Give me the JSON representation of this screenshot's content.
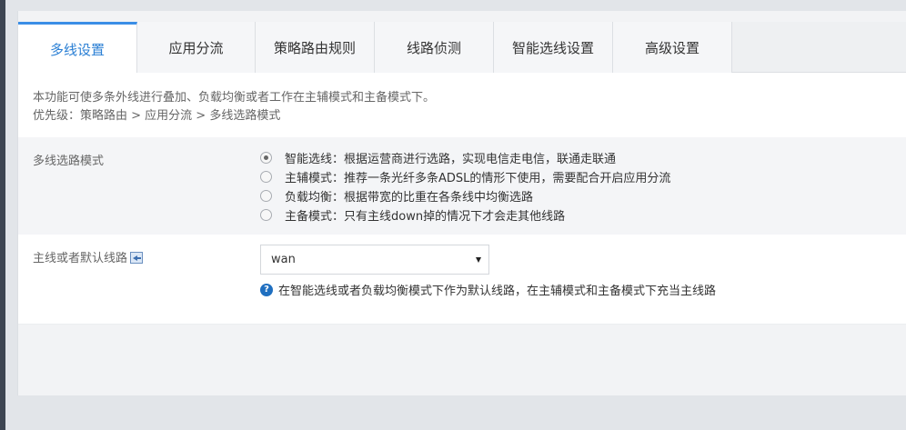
{
  "tabs": [
    {
      "label": "多线设置",
      "active": true
    },
    {
      "label": "应用分流",
      "active": false
    },
    {
      "label": "策略路由规则",
      "active": false
    },
    {
      "label": "线路侦测",
      "active": false
    },
    {
      "label": "智能选线设置",
      "active": false
    },
    {
      "label": "高级设置",
      "active": false
    }
  ],
  "description": {
    "line1": "本功能可使多条外线进行叠加、负载均衡或者工作在主辅模式和主备模式下。",
    "line2": "优先级：策略路由 > 应用分流 > 多线选路模式"
  },
  "mode": {
    "label": "多线选路模式",
    "options": [
      {
        "label": "智能选线：根据运营商进行选路，实现电信走电信，联通走联通",
        "checked": true
      },
      {
        "label": "主辅模式：推荐一条光纤多条ADSL的情形下使用，需要配合开启应用分流",
        "checked": false
      },
      {
        "label": "负载均衡：根据带宽的比重在各条线中均衡选路",
        "checked": false
      },
      {
        "label": "主备模式：只有主线down掉的情况下才会走其他线路",
        "checked": false
      }
    ]
  },
  "default_line": {
    "label": "主线或者默认线路",
    "selected": "wan",
    "hint": "在智能选线或者负载均衡模式下作为默认线路，在主辅模式和主备模式下充当主线路"
  },
  "icons": {
    "label_icon": "back-arrow-icon",
    "hint_icon": "help-icon"
  },
  "colors": {
    "accent": "#3a8ee6",
    "active_tab_text": "#2a7fd4",
    "help_icon": "#1f6fc0"
  }
}
